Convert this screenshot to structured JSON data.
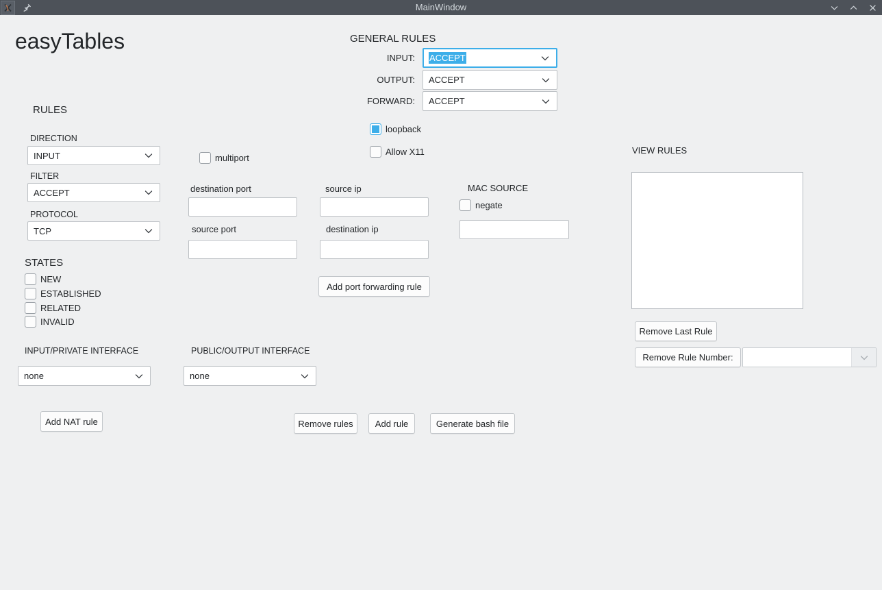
{
  "window": {
    "title": "MainWindow",
    "app_icon": "application-icon",
    "pin_icon": "pin-icon",
    "controls": [
      {
        "name": "minimize-button",
        "icon": "chevron-down-icon"
      },
      {
        "name": "maximize-button",
        "icon": "chevron-up-icon"
      },
      {
        "name": "close-button",
        "icon": "close-icon"
      }
    ]
  },
  "app": {
    "title": "easyTables"
  },
  "colors": {
    "titlebar_bg": "#4d5259",
    "window_bg": "#eff0f1",
    "accent": "#3daee9",
    "text": "#232629",
    "field_bg": "#ffffff"
  },
  "general_rules": {
    "heading": "GENERAL RULES",
    "input": {
      "label": "INPUT:",
      "value": "ACCEPT",
      "selected": true
    },
    "output": {
      "label": "OUTPUT:",
      "value": "ACCEPT"
    },
    "forward": {
      "label": "FORWARD:",
      "value": "ACCEPT"
    },
    "loopback": {
      "label": "loopback",
      "checked": true
    },
    "allow_x11": {
      "label": "Allow X11",
      "checked": false
    }
  },
  "rules": {
    "heading": "RULES",
    "direction": {
      "label": "DIRECTION",
      "value": "INPUT"
    },
    "filter": {
      "label": "FILTER",
      "value": "ACCEPT"
    },
    "protocol": {
      "label": "PROTOCOL",
      "value": "TCP"
    },
    "states": {
      "heading": "STATES",
      "items": [
        {
          "label": "NEW",
          "checked": false
        },
        {
          "label": "ESTABLISHED",
          "checked": false
        },
        {
          "label": "RELATED",
          "checked": false
        },
        {
          "label": "INVALID",
          "checked": false
        }
      ]
    }
  },
  "ports": {
    "multiport": {
      "label": "multiport",
      "checked": false
    },
    "destination_port": {
      "label": "destination port",
      "value": ""
    },
    "source_port": {
      "label": "source port",
      "value": ""
    },
    "source_ip": {
      "label": "source ip",
      "value": ""
    },
    "destination_ip": {
      "label": "destination ip",
      "value": ""
    },
    "add_port_forwarding_rule": "Add port forwarding rule"
  },
  "mac_source": {
    "heading": "MAC SOURCE",
    "negate": {
      "label": "negate",
      "checked": false
    },
    "value": ""
  },
  "interfaces": {
    "input_private": {
      "label": "INPUT/PRIVATE INTERFACE",
      "value": "none"
    },
    "public_output": {
      "label": "PUBLIC/OUTPUT INTERFACE",
      "value": "none"
    }
  },
  "actions": {
    "add_nat_rule": "Add NAT rule",
    "remove_rules": "Remove rules",
    "add_rule": "Add rule",
    "generate_bash_file": "Generate bash file"
  },
  "view_rules": {
    "heading": "VIEW RULES",
    "list_items": [],
    "remove_last_rule": "Remove Last Rule",
    "remove_rule_number": "Remove Rule Number:",
    "rule_number_value": ""
  }
}
